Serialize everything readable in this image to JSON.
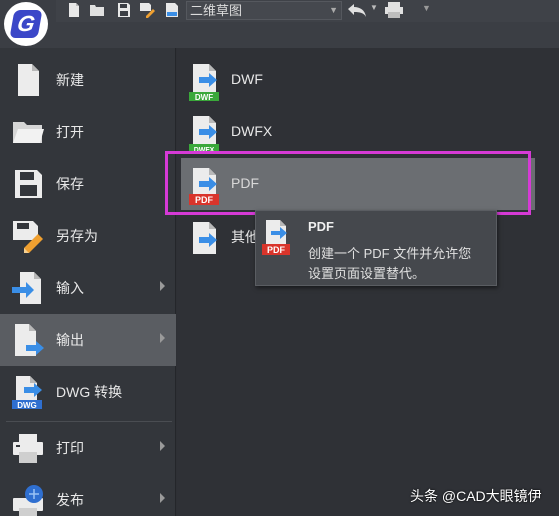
{
  "toolbar": {
    "workspace_value": "二维草图",
    "icons": [
      "new-icon",
      "open-icon",
      "save-icon",
      "save-as-icon",
      "cloud-icon",
      "undo-icon",
      "plot-icon"
    ]
  },
  "left_menu": {
    "items": [
      {
        "label": "新建",
        "icon": "new-file-icon"
      },
      {
        "label": "打开",
        "icon": "open-folder-icon"
      },
      {
        "label": "保存",
        "icon": "save-disk-icon"
      },
      {
        "label": "另存为",
        "icon": "save-as-icon"
      },
      {
        "label": "输入",
        "icon": "import-icon",
        "has_submenu": true
      },
      {
        "label": "输出",
        "icon": "export-icon",
        "has_submenu": true,
        "active": true
      },
      {
        "label": "DWG 转换",
        "icon": "dwg-convert-icon"
      },
      {
        "label": "打印",
        "icon": "print-icon",
        "has_submenu": true
      },
      {
        "label": "发布",
        "icon": "publish-icon",
        "has_submenu": true
      }
    ]
  },
  "submenu": {
    "items": [
      {
        "label": "DWF",
        "badge": "DWF",
        "badge_color": "#3aa83a"
      },
      {
        "label": "DWFX",
        "badge": "DWFX",
        "badge_color": "#3aa83a"
      },
      {
        "label": "PDF",
        "badge": "PDF",
        "badge_color": "#d9342b",
        "active": true
      },
      {
        "label": "其他"
      }
    ]
  },
  "tooltip": {
    "title": "PDF",
    "line1": "创建一个 PDF 文件并允许您",
    "line2": "设置页面设置替代。",
    "badge": "PDF"
  },
  "watermark": "头条 @CAD大眼镜伊",
  "colors": {
    "highlight": "#d63ad6",
    "arrow_blue": "#3a8ee6",
    "logo_blue": "#3b47c8"
  }
}
